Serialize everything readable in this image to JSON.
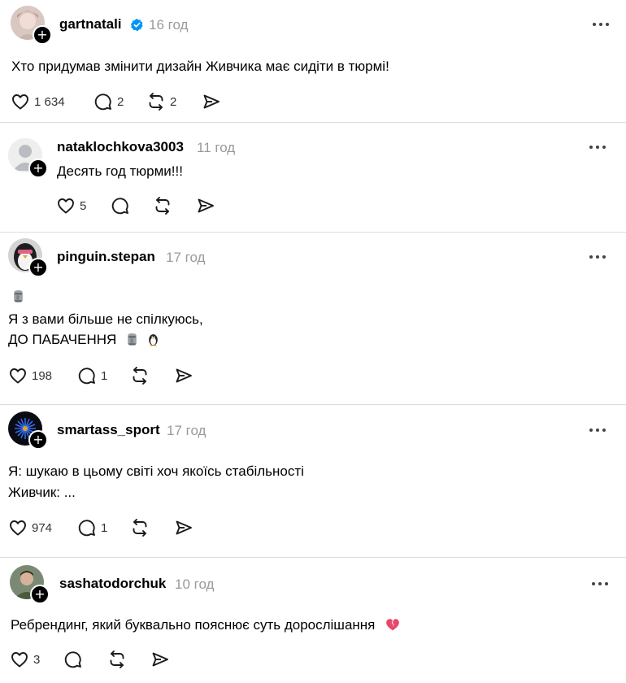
{
  "posts": [
    {
      "username": "gartnatali",
      "verified": true,
      "time": "16 год",
      "lines": [
        "Хто придумав змінити дизайн Живчика має сидіти в тюрмі!"
      ],
      "likes": "1 634",
      "replies": "2",
      "reposts": "2"
    },
    {
      "username": "nataklochkova3003",
      "time": "11 год",
      "lines": [
        "Десять год тюрми!!!"
      ],
      "likes": "5"
    },
    {
      "username": "pinguin.stepan",
      "time": "17 год",
      "lines": [
        "Я з вами більше не спілкуюсь,",
        "ДО ПАБАЧЕННЯ"
      ],
      "likes": "198",
      "replies": "1"
    },
    {
      "username": "smartass_sport",
      "time": "17 год",
      "lines": [
        "Я: шукаю в цьому світі хоч якоїсь стабільності",
        "Живчик: ..."
      ],
      "likes": "974",
      "replies": "1"
    },
    {
      "username": "sashatodorchuk",
      "time": "10 год",
      "lines": [
        "Ребрендинг, який буквально пояснює суть дорослішання"
      ],
      "likes": "3"
    }
  ],
  "icons": {
    "follow": "plus",
    "more": "more-dots",
    "like": "heart",
    "reply": "comment",
    "repost": "repost",
    "share": "send"
  },
  "colors": {
    "verified": "#0095f6",
    "muted": "#9a9a9a",
    "divider": "#dcdcdc"
  }
}
